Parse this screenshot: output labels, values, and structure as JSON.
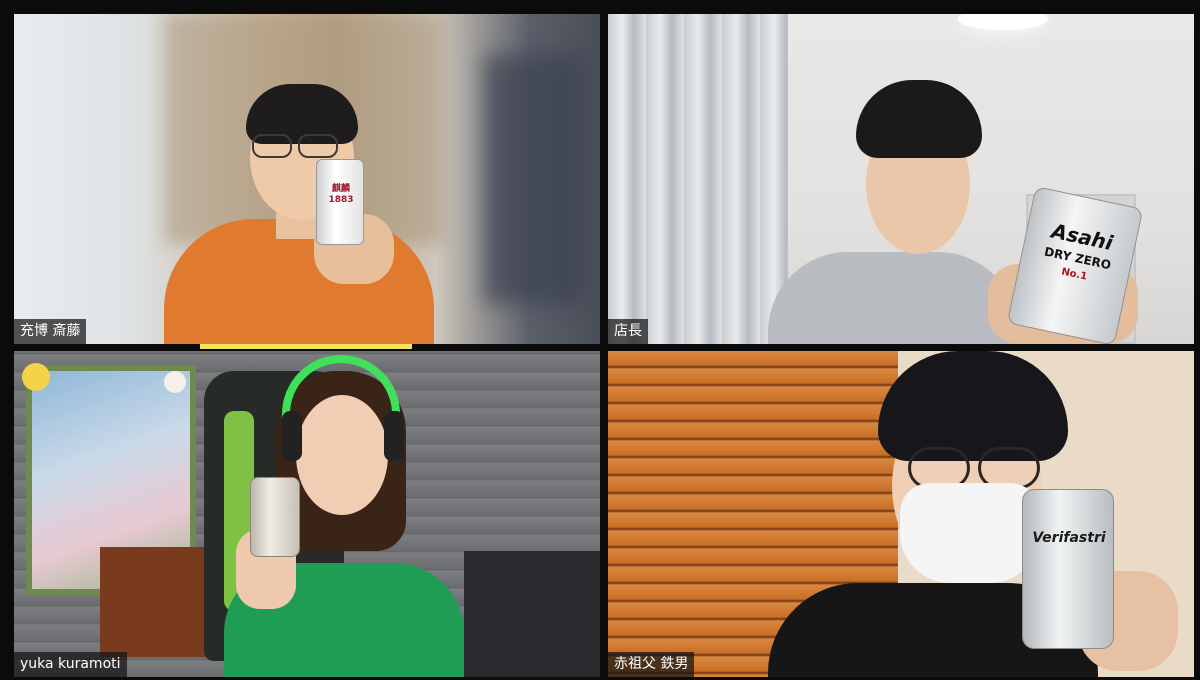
{
  "participants": [
    {
      "name": "充博 斎藤",
      "active_speaker": true
    },
    {
      "name": "店長",
      "active_speaker": false
    },
    {
      "name": "yuka kuramoti",
      "active_speaker": false
    },
    {
      "name": "赤祖父 鉄男",
      "active_speaker": false
    }
  ],
  "cans": {
    "can1": "麒麟\n1883",
    "can2_line1": "Asahi",
    "can2_line2": "DRY ZERO",
    "can2_line3": "No.1",
    "can4": "Verifastri"
  },
  "colors": {
    "speaker_highlight": "#f3e45a",
    "background": "#0b0b0b"
  }
}
